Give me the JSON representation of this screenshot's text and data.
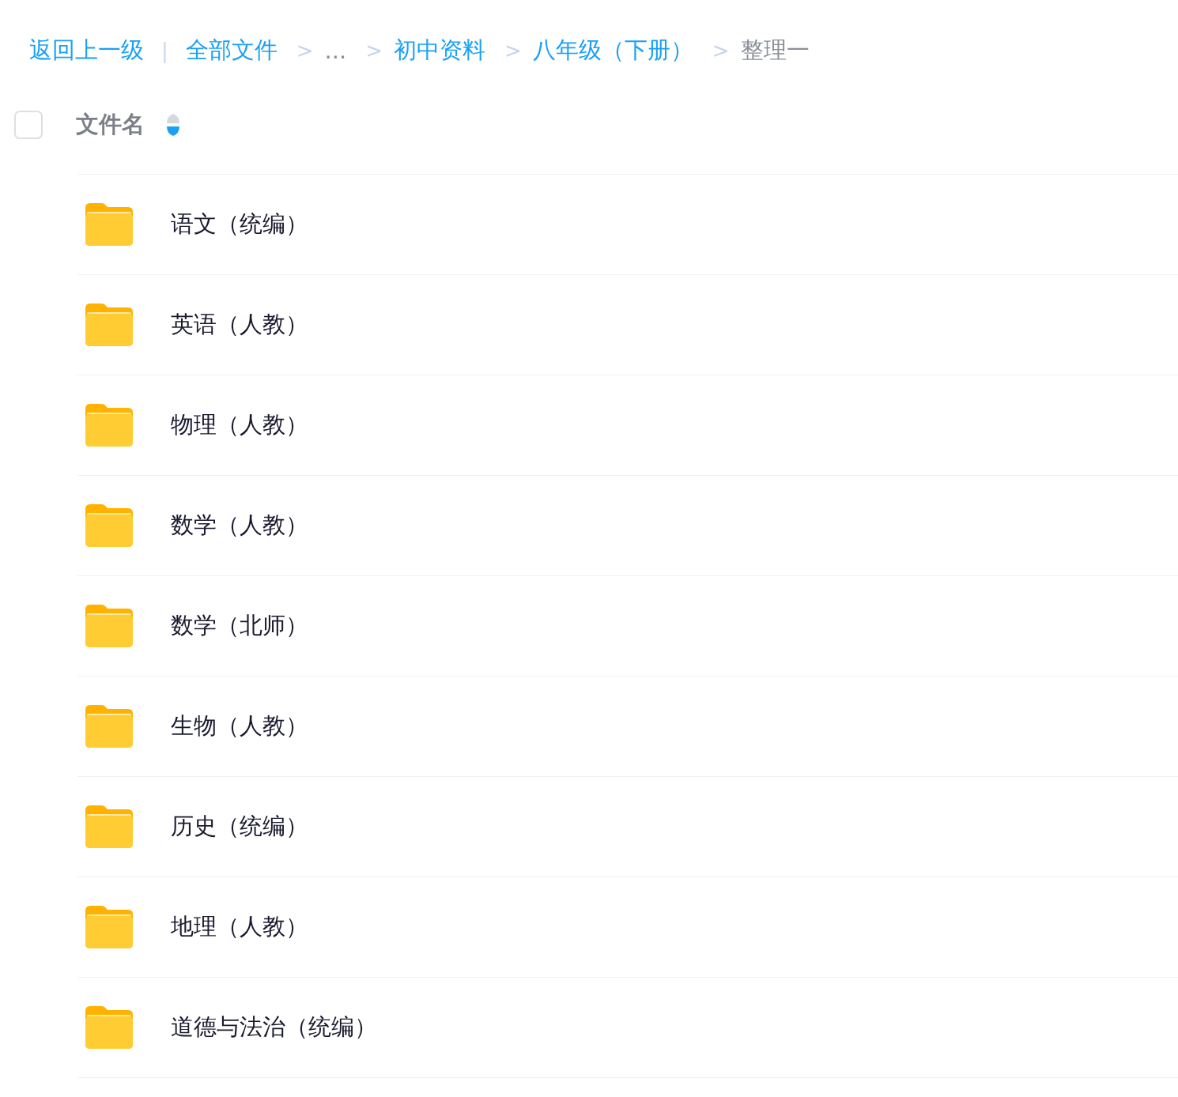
{
  "breadcrumb": {
    "back": "返回上一级",
    "divider": "|",
    "items": [
      {
        "kind": "link",
        "label": "全部文件"
      },
      {
        "kind": "ellipsis",
        "separator": ">",
        "label": "..."
      },
      {
        "kind": "link",
        "separator": ">",
        "label": "初中资料"
      },
      {
        "kind": "link",
        "separator": ">",
        "label": "八年级（下册）"
      },
      {
        "kind": "current",
        "separator": ">",
        "label": "整理一"
      }
    ]
  },
  "header": {
    "checked": false,
    "column": "文件名",
    "sort_descending": true
  },
  "rows": [
    {
      "kind": "folder",
      "name": "语文（统编）"
    },
    {
      "kind": "folder",
      "name": "英语（人教）"
    },
    {
      "kind": "folder",
      "name": "物理（人教）"
    },
    {
      "kind": "folder",
      "name": "数学（人教）"
    },
    {
      "kind": "folder",
      "name": "数学（北师）"
    },
    {
      "kind": "folder",
      "name": "生物（人教）"
    },
    {
      "kind": "folder",
      "name": "历史（统编）"
    },
    {
      "kind": "folder",
      "name": "地理（人教）"
    },
    {
      "kind": "folder",
      "name": "道德与法治（统编）"
    }
  ]
}
